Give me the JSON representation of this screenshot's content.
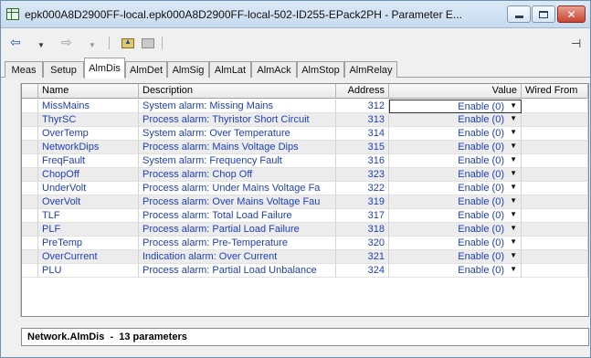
{
  "window": {
    "title": "epk000A8D2900FF-local.epk000A8D2900FF-local-502-ID255-EPack2PH - Parameter E..."
  },
  "toolbar": {
    "back_icon": "arrow-left-icon",
    "forward_icon": "arrow-right-icon",
    "up_icon": "folder-up-icon",
    "folder_icon": "folder-icon",
    "pin_icon": "pin-icon"
  },
  "tabs": [
    {
      "label": "Meas"
    },
    {
      "label": "Setup"
    },
    {
      "label": "AlmDis"
    },
    {
      "label": "AlmDet"
    },
    {
      "label": "AlmSig"
    },
    {
      "label": "AlmLat"
    },
    {
      "label": "AlmAck"
    },
    {
      "label": "AlmStop"
    },
    {
      "label": "AlmRelay"
    }
  ],
  "active_tab": "AlmDis",
  "columns": {
    "name": "Name",
    "description": "Description",
    "address": "Address",
    "value": "Value",
    "wired_from": "Wired From"
  },
  "rows": [
    {
      "name": "MissMains",
      "description": "System alarm: Missing Mains",
      "address": "312",
      "value": "Enable (0)"
    },
    {
      "name": "ThyrSC",
      "description": "Process alarm: Thyristor Short Circuit",
      "address": "313",
      "value": "Enable (0)"
    },
    {
      "name": "OverTemp",
      "description": "System alarm: Over Temperature",
      "address": "314",
      "value": "Enable (0)"
    },
    {
      "name": "NetworkDips",
      "description": "Process alarm: Mains Voltage Dips",
      "address": "315",
      "value": "Enable (0)"
    },
    {
      "name": "FreqFault",
      "description": "System alarm: Frequency Fault",
      "address": "316",
      "value": "Enable (0)"
    },
    {
      "name": "ChopOff",
      "description": "Process alarm: Chop Off",
      "address": "323",
      "value": "Enable (0)"
    },
    {
      "name": "UnderVolt",
      "description": "Process alarm: Under Mains Voltage Fa",
      "address": "322",
      "value": "Enable (0)"
    },
    {
      "name": "OverVolt",
      "description": "Process alarm: Over Mains Voltage Fau",
      "address": "319",
      "value": "Enable (0)"
    },
    {
      "name": "TLF",
      "description": "Process alarm: Total Load Failure",
      "address": "317",
      "value": "Enable (0)"
    },
    {
      "name": "PLF",
      "description": "Process alarm: Partial Load Failure",
      "address": "318",
      "value": "Enable (0)"
    },
    {
      "name": "PreTemp",
      "description": "Process alarm: Pre-Temperature",
      "address": "320",
      "value": "Enable (0)"
    },
    {
      "name": "OverCurrent",
      "description": "Indication alarm: Over Current",
      "address": "321",
      "value": "Enable (0)"
    },
    {
      "name": "PLU",
      "description": "Process alarm: Partial Load Unbalance",
      "address": "324",
      "value": "Enable (0)"
    }
  ],
  "status": {
    "text": "Network.AlmDis  -  13 parameters"
  }
}
